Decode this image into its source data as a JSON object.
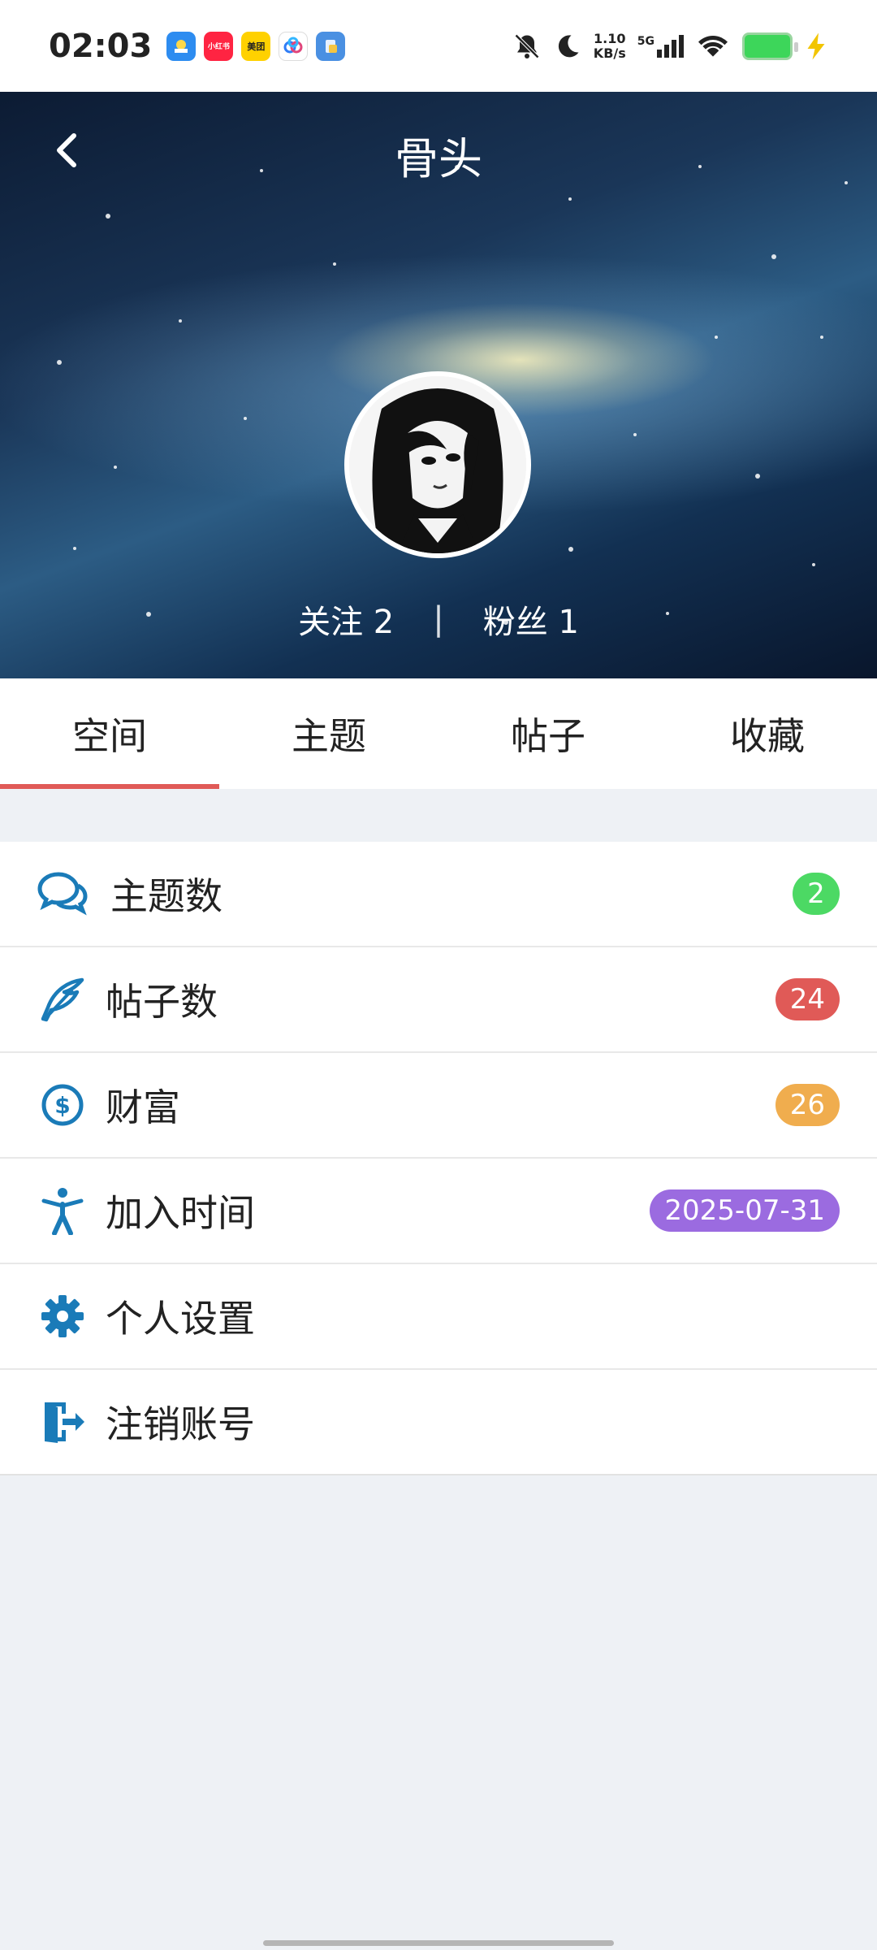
{
  "status_bar": {
    "time": "02:03",
    "app_icons": [
      {
        "name": "gallery-app-icon",
        "color": "#2d8cf0",
        "label": ""
      },
      {
        "name": "xiaohongshu-app-icon",
        "color": "#ff2442",
        "label": "小红书"
      },
      {
        "name": "meituan-app-icon",
        "color": "#ffd100",
        "label": "美团"
      },
      {
        "name": "baidu-netdisk-app-icon",
        "color": "#ffffff",
        "label": ""
      },
      {
        "name": "files-app-icon",
        "color": "#4a90e2",
        "label": ""
      }
    ],
    "speed_top": "1.10",
    "speed_bottom": "KB/s",
    "network": "5G",
    "battery_color": "#3dd65a"
  },
  "header": {
    "title": "骨头",
    "follow_label": "关注 2",
    "separator": "|",
    "fans_label": "粉丝 1"
  },
  "tabs": [
    {
      "label": "空间",
      "active": true
    },
    {
      "label": "主题",
      "active": false
    },
    {
      "label": "帖子",
      "active": false
    },
    {
      "label": "收藏",
      "active": false
    }
  ],
  "accent_color": "#1a7bb8",
  "list": [
    {
      "label": "主题数",
      "icon": "comments-icon",
      "badge": "2",
      "badge_color": "#4cd964"
    },
    {
      "label": "帖子数",
      "icon": "feather-icon",
      "badge": "24",
      "badge_color": "#e05a57"
    },
    {
      "label": "财富",
      "icon": "dollar-icon",
      "badge": "26",
      "badge_color": "#f0ad4e"
    },
    {
      "label": "加入时间",
      "icon": "person-icon",
      "badge": "2025-07-31",
      "badge_color": "#9b6be0"
    },
    {
      "label": "个人设置",
      "icon": "gear-icon",
      "badge": null
    },
    {
      "label": "注销账号",
      "icon": "logout-icon",
      "badge": null
    }
  ]
}
